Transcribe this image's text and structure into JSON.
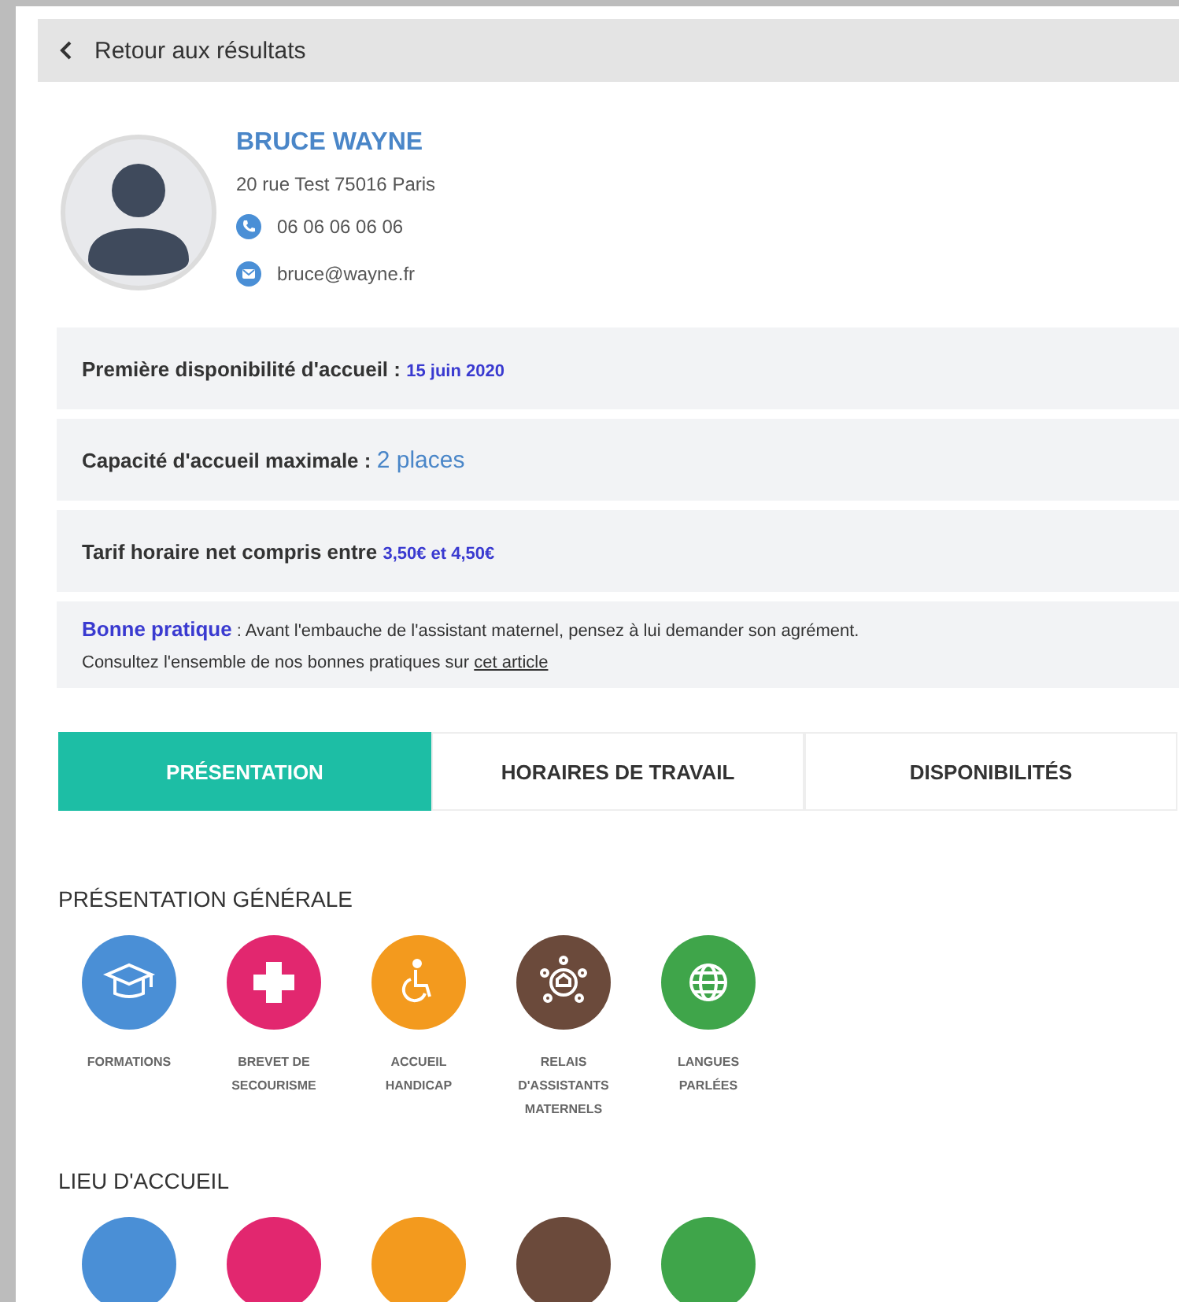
{
  "back_link": {
    "label": "Retour aux résultats"
  },
  "profile": {
    "name": "BRUCE WAYNE",
    "address": "20 rue Test 75016 Paris",
    "phone": "06 06 06 06 06",
    "email": "bruce@wayne.fr"
  },
  "info_rows": [
    {
      "label": "Première disponibilité d'accueil : ",
      "value": "15 juin 2020",
      "kind": "small"
    },
    {
      "label": "Capacité d'accueil maximale : ",
      "value": "2 places",
      "kind": "large"
    },
    {
      "label": "Tarif horaire net compris entre ",
      "value": "3,50€ et 4,50€",
      "kind": "small"
    }
  ],
  "tip": {
    "label": "Bonne pratique",
    "text": " : Avant l'embauche de l'assistant maternel, pensez à lui demander son agrément.",
    "line2": "Consultez l'ensemble de nos bonnes pratiques sur ",
    "link": "cet article"
  },
  "tabs": [
    {
      "label": "PRÉSENTATION",
      "selected": true
    },
    {
      "label": "HORAIRES DE TRAVAIL",
      "selected": false
    },
    {
      "label": "DISPONIBILITÉS",
      "selected": false
    }
  ],
  "sections": [
    {
      "title": "PRÉSENTATION GÉNÉRALE",
      "items": [
        {
          "kind": "cap",
          "color": "#4a8fd6",
          "label": "FORMATIONS"
        },
        {
          "kind": "cross",
          "color": "#e2276f",
          "label": "BREVET DE SECOURISME"
        },
        {
          "kind": "wheelchair",
          "color": "#f39a1e",
          "label": "ACCUEIL HANDICAP"
        },
        {
          "kind": "network",
          "color": "#6b4a3b",
          "label": "RELAIS D'ASSISTANTS MATERNELS"
        },
        {
          "kind": "globe",
          "color": "#3fa54a",
          "label": "LANGUES PARLÉES"
        }
      ]
    },
    {
      "title": "LIEU D'ACCUEIL",
      "items": [
        {
          "kind": "none",
          "color": "#4a8fd6"
        },
        {
          "kind": "none",
          "color": "#e2276f"
        },
        {
          "kind": "none",
          "color": "#f39a1e"
        },
        {
          "kind": "none",
          "color": "#6b4a3b"
        },
        {
          "kind": "none",
          "color": "#3fa54a"
        }
      ]
    }
  ]
}
